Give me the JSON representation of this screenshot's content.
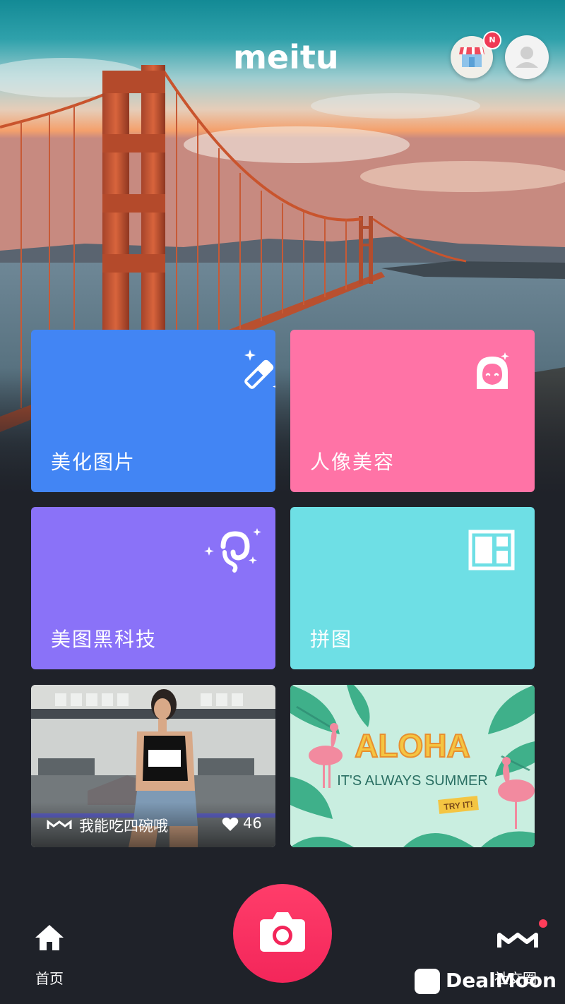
{
  "header": {
    "logo_text": "meitu",
    "store_badge": "N"
  },
  "tiles": [
    {
      "label": "美化图片",
      "color": "#4285f4",
      "icon": "magic-wand-icon"
    },
    {
      "label": "人像美容",
      "color": "#ff73a6",
      "icon": "face-icon"
    },
    {
      "label": "美图黑科技",
      "color": "#8a72f8",
      "icon": "hair-sparkle-icon"
    },
    {
      "label": "拼图",
      "color": "#6edfe5",
      "icon": "collage-layout-icon"
    }
  ],
  "feed": {
    "post_caption": "我能吃四碗哦",
    "post_likes": "46",
    "banner_title": "ALOHA",
    "banner_subtitle": "IT'S ALWAYS SUMMER",
    "banner_cta": "TRY IT!"
  },
  "bottom_nav": {
    "home_label": "首页",
    "social_label": "社交圈"
  },
  "watermark": {
    "text": "DealMoon"
  },
  "colors": {
    "background": "#1f2229",
    "camera_button": "#ff3d6a",
    "badge": "#ef3a55"
  }
}
